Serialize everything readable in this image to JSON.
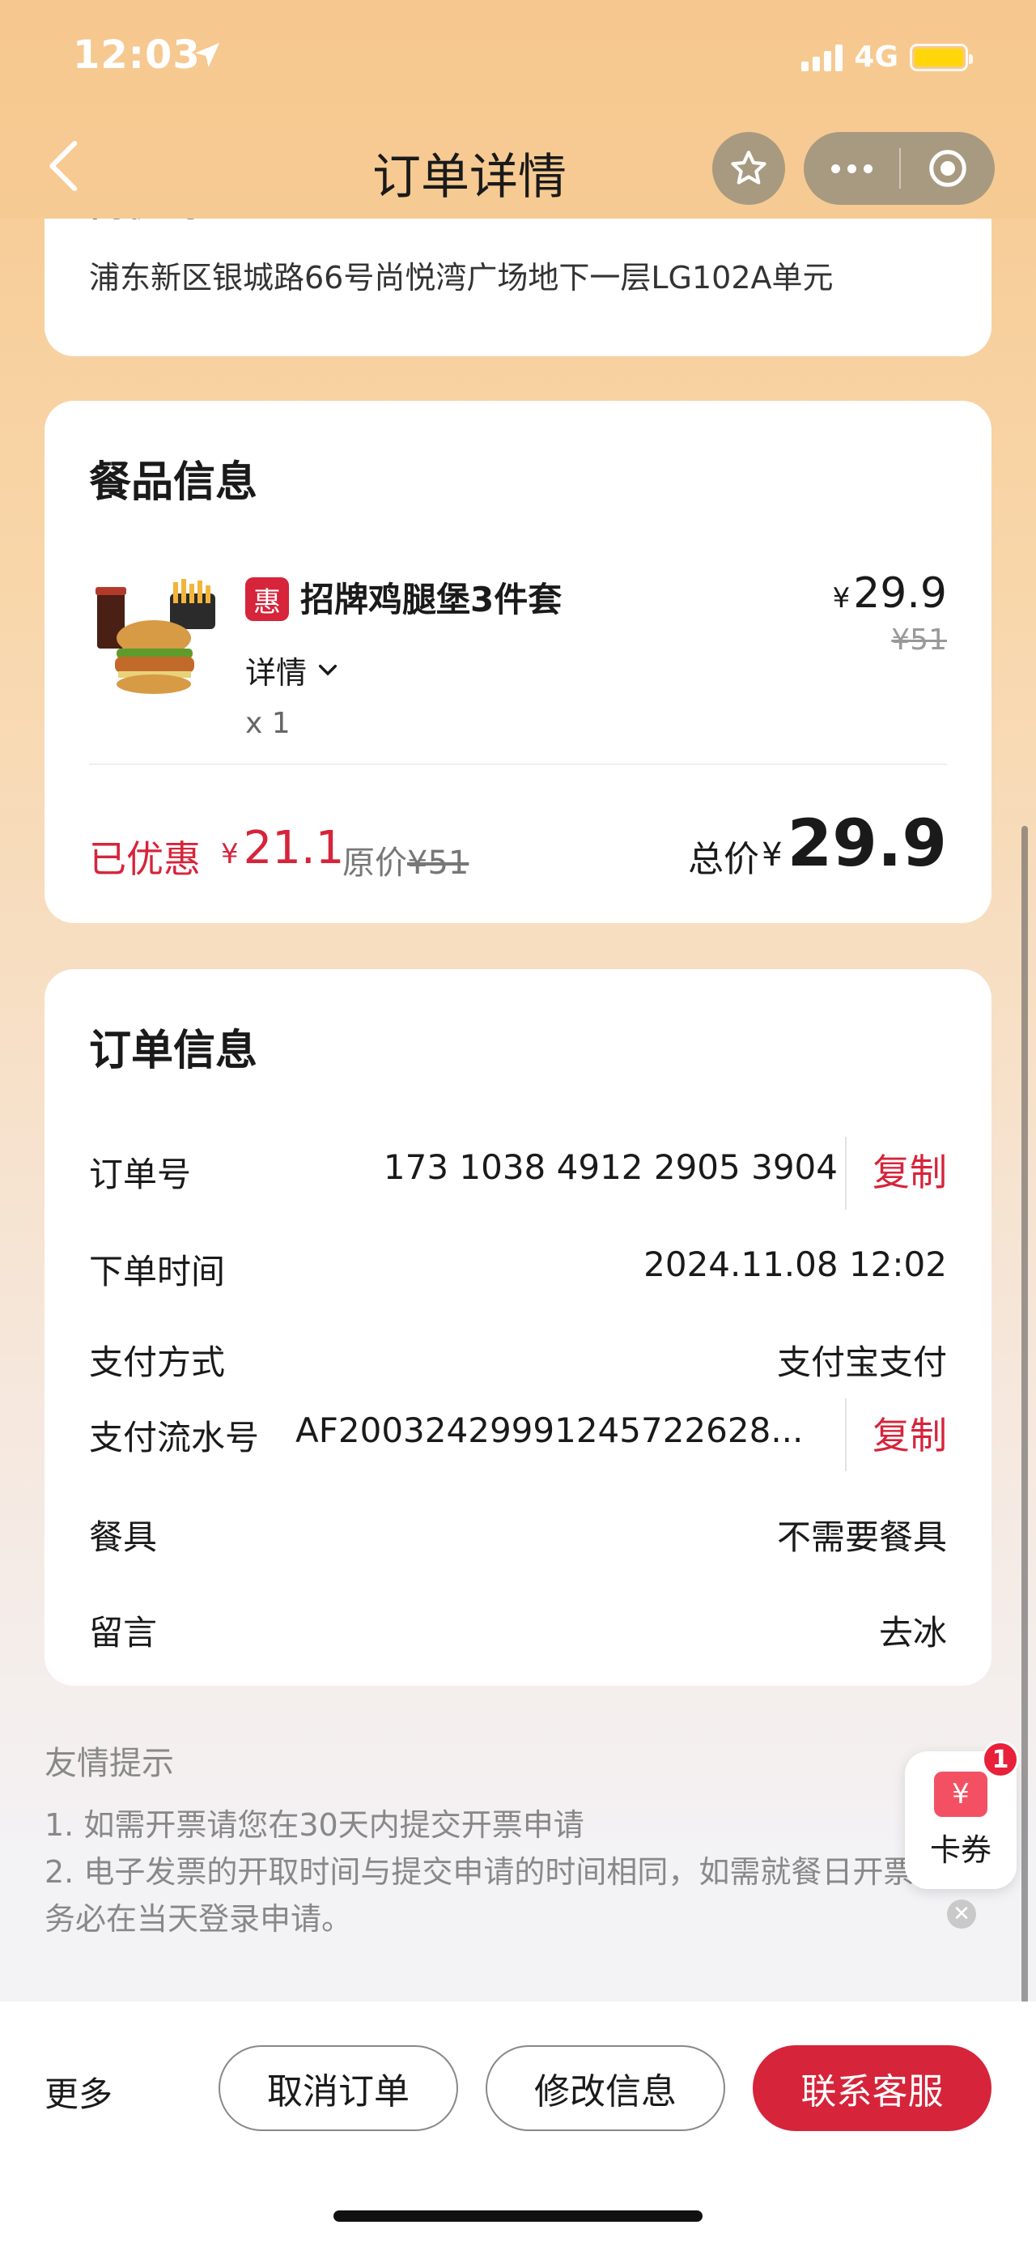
{
  "status_bar": {
    "time": "12:03",
    "network": "4G"
  },
  "nav": {
    "title": "订单详情"
  },
  "address": {
    "name_partial": "尚悦湾",
    "line": "浦东新区银城路66号尚悦湾广场地下一层LG102A单元"
  },
  "food": {
    "section_title": "餐品信息",
    "badge": "惠",
    "item_name": "招牌鸡腿堡3件套",
    "detail_label": "详情",
    "quantity": "x 1",
    "price_currency": "¥",
    "price": "29.9",
    "original_price": "¥51",
    "discount_label": "已优惠",
    "discount_currency": "¥",
    "discount_amount": "21.1",
    "orig_label": "原价",
    "orig_value": "¥51",
    "total_label": "总价",
    "total_currency": "¥",
    "total": "29.9"
  },
  "order": {
    "section_title": "订单信息",
    "rows": [
      {
        "label": "订单号",
        "value": "173 1038 4912 2905 3904",
        "action": "复制"
      },
      {
        "label": "下单时间",
        "value": "2024.11.08 12:02"
      },
      {
        "label": "支付方式",
        "value": "支付宝支付"
      },
      {
        "label": "支付流水号",
        "value": "AF20032429991245722628...",
        "action": "复制"
      },
      {
        "label": "餐具",
        "value": "不需要餐具"
      },
      {
        "label": "留言",
        "value": "去冰"
      }
    ]
  },
  "tips": {
    "title": "友情提示",
    "line1": "1. 如需开票请您在30天内提交开票申请",
    "line2": "2. 电子发票的开取时间与提交申请的时间相同，如需就餐日开票",
    "line3": "务必在当天登录申请。"
  },
  "coupon": {
    "icon": "¥",
    "label": "卡券",
    "badge": "1"
  },
  "bottom": {
    "more": "更多",
    "cancel": "取消订单",
    "modify": "修改信息",
    "contact": "联系客服"
  },
  "colors": {
    "brand_red": "#d6243a",
    "header_gold": "#f6c88f"
  }
}
